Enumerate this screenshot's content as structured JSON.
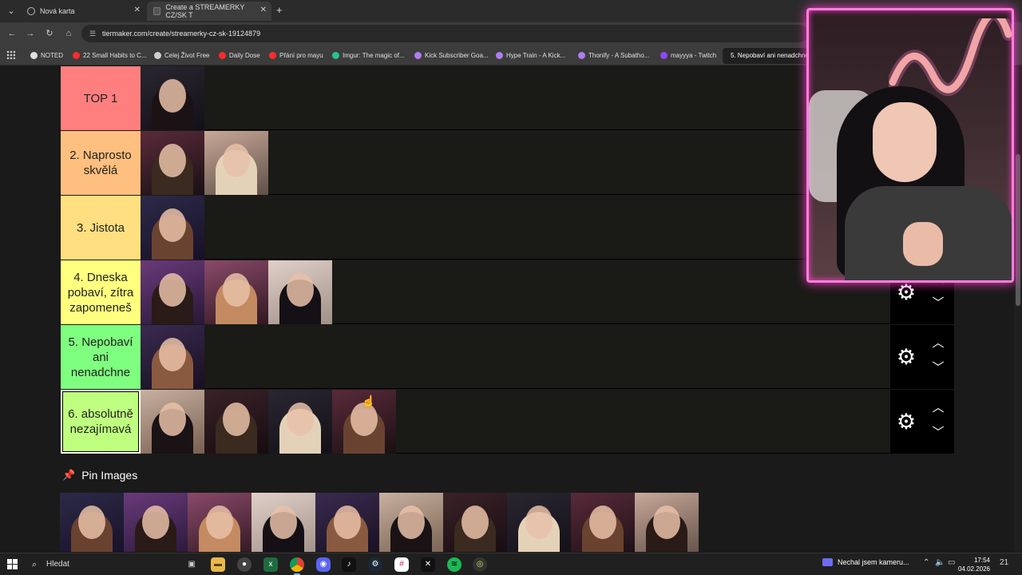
{
  "browser": {
    "tabs": [
      {
        "title": "Nová karta"
      },
      {
        "title": "Create a STREAMERKY CZ/SK T"
      }
    ],
    "url": "tiermaker.com/create/streamerky-cz-sk-19124879",
    "bookmarks": [
      {
        "label": "NOTED",
        "color": "#e0e0e0"
      },
      {
        "label": "22 Small Habits to C...",
        "color": "#ff2b2b"
      },
      {
        "label": "Celej Život Free",
        "color": "#cfcfcf"
      },
      {
        "label": "Daily Dose",
        "color": "#ff2b2b"
      },
      {
        "label": "Přání pro mayu",
        "color": "#ff2b2b"
      },
      {
        "label": "Imgur: The magic of...",
        "color": "#28c28a"
      },
      {
        "label": "Kick Subscriber Goa...",
        "color": "#b07cf0"
      },
      {
        "label": "Hype Train - A Kick...",
        "color": "#b07cf0"
      },
      {
        "label": "Thonify - A Subatho...",
        "color": "#b07cf0"
      },
      {
        "label": "mayyya - Twitch",
        "color": "#9146ff"
      }
    ],
    "active_bookmark_popup": "5. Nepobaví ani nenadchne"
  },
  "tiers": [
    {
      "label": "TOP 1",
      "color": "#ff7f7f",
      "items": 1
    },
    {
      "label": "2. Naprosto skvělá",
      "color": "#ffbf7f",
      "items": 2
    },
    {
      "label": "3. Jistota",
      "color": "#ffdf7f",
      "items": 1
    },
    {
      "label": "4. Dneska pobaví, zítra zapomeneš",
      "color": "#ffff7f",
      "items": 3
    },
    {
      "label": "5. Nepobaví ani nenadchne",
      "color": "#7fff7f",
      "items": 1
    },
    {
      "label": "6. absolutně nezajímavá",
      "color": "#bfff7f",
      "items": 4
    }
  ],
  "pin_images": {
    "title": "Pin Images",
    "count": 10
  },
  "taskbar": {
    "search_placeholder": "Hledat",
    "notification_text": "Nechal jsem kameru...",
    "time": "17:54",
    "date": "04.02.2026",
    "notification_count": "21"
  }
}
